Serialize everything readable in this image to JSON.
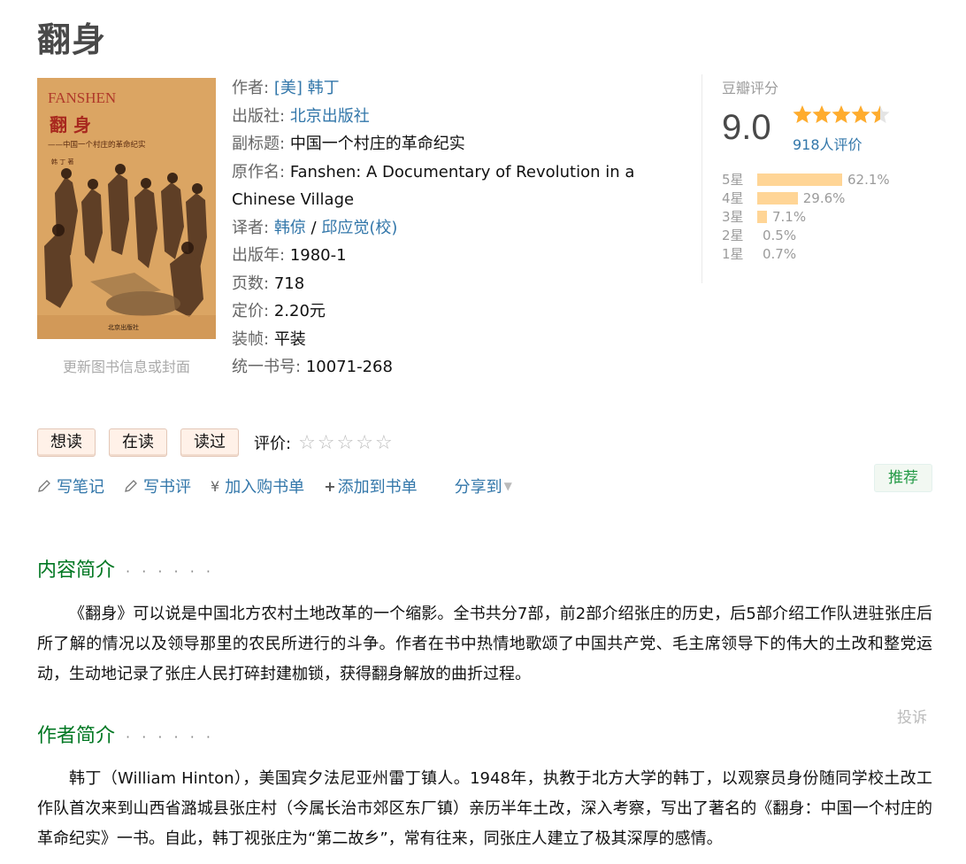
{
  "book": {
    "title": "翻身"
  },
  "cover": {
    "top_text": "FANSHEN",
    "big_title": "翻 身",
    "subtitle": "——中国一个村庄的革命纪实",
    "author_line": "韩 丁 著",
    "publisher_line": "北京出版社",
    "update_link": "更新图书信息或封面"
  },
  "info": {
    "author_label": "作者:",
    "author_value": "[美] 韩丁",
    "publisher_label": "出版社:",
    "publisher_value": "北京出版社",
    "subtitle_label": "副标题:",
    "subtitle_value": "中国一个村庄的革命纪实",
    "original_label": "原作名:",
    "original_value": "Fanshen: A Documentary of Revolution in a Chinese Village",
    "translator_label": "译者:",
    "translator_1": "韩倞",
    "translator_sep": "/",
    "translator_2": "邱应觉(校)",
    "year_label": "出版年:",
    "year_value": "1980-1",
    "pages_label": "页数:",
    "pages_value": "718",
    "price_label": "定价:",
    "price_value": "2.20元",
    "binding_label": "装帧:",
    "binding_value": "平装",
    "isbn_label": "统一书号:",
    "isbn_value": "10071-268"
  },
  "rating": {
    "label": "豆瓣评分",
    "score": "9.0",
    "score_fraction": 0.9,
    "votes": "918人评价",
    "bars": [
      {
        "label": "5星",
        "percent": "62.1%",
        "value": 62.1
      },
      {
        "label": "4星",
        "percent": "29.6%",
        "value": 29.6
      },
      {
        "label": "3星",
        "percent": "7.1%",
        "value": 7.1
      },
      {
        "label": "2星",
        "percent": "0.5%",
        "value": 0.5
      },
      {
        "label": "1星",
        "percent": "0.7%",
        "value": 0.7
      }
    ],
    "star_color": "#ffac2d"
  },
  "actions": {
    "want": "想读",
    "reading": "在读",
    "read": "读过",
    "rate_label": "评价:",
    "rate_stars": "☆☆☆☆☆",
    "write_note": "写笔记",
    "write_review": "写书评",
    "cart_icon": "¥",
    "add_cart": "加入购书单",
    "add_list_icon": "+",
    "add_list": "添加到书单",
    "share": "分享到",
    "recommend": "推荐"
  },
  "intro": {
    "heading": "内容简介",
    "dots": "· · · · · ·",
    "text": "《翻身》可以说是中国北方农村土地改革的一个缩影。全书共分7部，前2部介绍张庄的历史，后5部介绍工作队进驻张庄后所了解的情况以及领导那里的农民所进行的斗争。作者在书中热情地歌颂了中国共产党、毛主席领导下的伟大的土改和整党运动，生动地记录了张庄人民打碎封建枷锁，获得翻身解放的曲折过程。"
  },
  "author_intro": {
    "heading": "作者简介",
    "dots": "· · · · · ·",
    "report": "投诉",
    "text": "韩丁（William Hinton），美国宾夕法尼亚州雷丁镇人。1948年，执教于北方大学的韩丁，以观察员身份随同学校土改工作队首次来到山西省潞城县张庄村（今属长治市郊区东厂镇）亲历半年土改，深入考察，写出了著名的《翻身：中国一个村庄的革命纪实》一书。自此，韩丁视张庄为“第二故乡”，常有往来，同张庄人建立了极其深厚的感情。"
  }
}
